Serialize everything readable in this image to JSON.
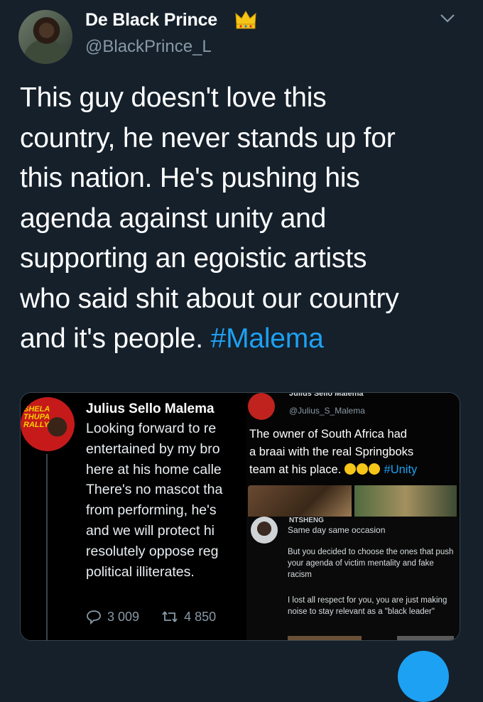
{
  "header": {
    "display_name": "De Black Prince",
    "handle": "@BlackPrince_L",
    "badge_icon": "crown-emoji",
    "menu_icon": "chevron-down-icon"
  },
  "tweet": {
    "lines": [
      "This guy doesn't love this",
      "country, he never stands up for",
      "this nation. He's pushing his",
      "agenda against unity and",
      "supporting an egoistic artists",
      "who said shit about our country"
    ],
    "last_line_text": "and it's people.",
    "hashtag": "#Malema"
  },
  "embedded_image": {
    "left_tweet": {
      "avatar_text": "SHELA THUPA RALLY",
      "name": "Julius Sello Malema",
      "lines": [
        "Looking forward to re",
        "entertained by my bro",
        "here at his home calle",
        "There's no mascot tha",
        "from performing, he's",
        "and we will protect hi",
        "resolutely oppose reg",
        "political illiterates."
      ],
      "reply_count": "3 009",
      "retweet_count": "4 850"
    },
    "right_top_tweet": {
      "name": "Julius Sello Malema",
      "handle": "@Julius_S_Malema",
      "lines": [
        "The owner of South Africa had",
        "a braai with the real Springboks"
      ],
      "last_line": "team at his place.",
      "hashtag": "#Unity"
    },
    "right_bottom_tweet": {
      "header": "NTSHENG",
      "line1": "Same day same occasion",
      "para1": "But you decided to choose the ones that push your agenda of victim mentality and fake racism",
      "para2": "I lost all respect for you, you are just making noise to stay relevant as a \"black leader\""
    }
  },
  "colors": {
    "background": "#15202b",
    "accent": "#1da1f2",
    "secondary_text": "#8899a6"
  }
}
